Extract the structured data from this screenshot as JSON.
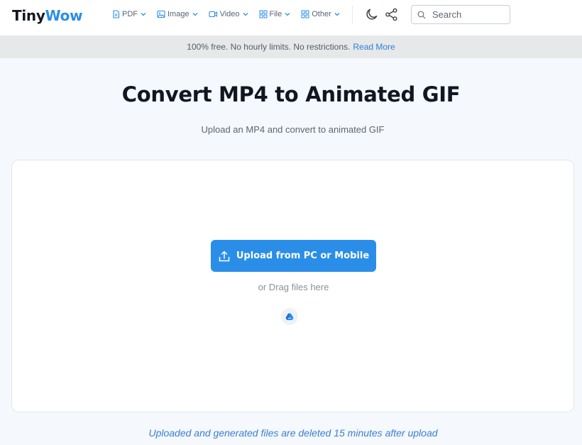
{
  "brand": {
    "part1": "Tiny",
    "part2": "Wow"
  },
  "nav": {
    "items": [
      {
        "label": "PDF",
        "icon": "document-icon"
      },
      {
        "label": "Image",
        "icon": "image-icon"
      },
      {
        "label": "Video",
        "icon": "video-icon"
      },
      {
        "label": "File",
        "icon": "grid-icon"
      },
      {
        "label": "Other",
        "icon": "grid-icon"
      }
    ],
    "search_placeholder": "Search"
  },
  "banner": {
    "text": "100% free. No hourly limits. No restrictions.",
    "link": "Read More"
  },
  "page": {
    "title": "Convert MP4 to Animated GIF",
    "subtitle": "Upload an MP4 and convert to animated GIF"
  },
  "upload": {
    "button_label": "Upload from PC or Mobile",
    "drag_text": "or Drag files here",
    "cloud_icon": "google-drive-icon"
  },
  "footnote": "Uploaded and generated files are deleted 15 minutes after upload",
  "colors": {
    "accent": "#2a8ee8",
    "link": "#2b7fd6",
    "banner_bg": "#e7e8ea"
  }
}
